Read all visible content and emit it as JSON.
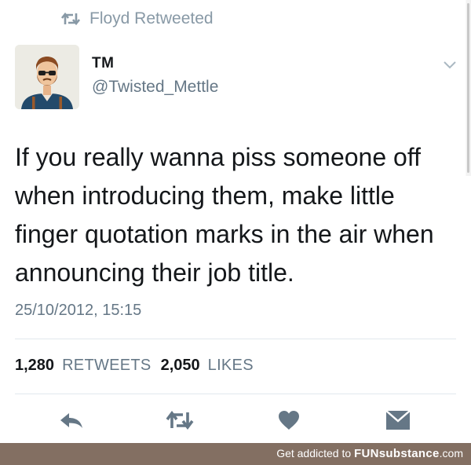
{
  "retweet_context": {
    "icon": "retweet-icon",
    "text": "Floyd Retweeted"
  },
  "author": {
    "avatar_icon": "bearded-man-avatar",
    "name": "TM",
    "handle": "@Twisted_Mettle"
  },
  "menu": {
    "icon": "chevron-down-icon"
  },
  "tweet": {
    "text_lines": [
      "If you really wanna piss someone off",
      "when introducing them, make little",
      "finger quotation marks in the air when",
      "announcing their job title."
    ],
    "timestamp": "25/10/2012, 15:15"
  },
  "stats": {
    "retweets_count": "1,280",
    "retweets_label": "RETWEETS",
    "likes_count": "2,050",
    "likes_label": "LIKES"
  },
  "actions": [
    {
      "name": "reply",
      "icon": "reply-icon"
    },
    {
      "name": "retweet",
      "icon": "retweet-icon"
    },
    {
      "name": "like",
      "icon": "heart-icon"
    },
    {
      "name": "direct-message",
      "icon": "envelope-icon"
    }
  ],
  "footer": {
    "prefix": "Get addicted to ",
    "brand": "FUNsubstance",
    "suffix": ".com"
  },
  "colors": {
    "text_primary": "#14171a",
    "text_secondary": "#657786",
    "icon_gray": "#8899a6",
    "footer_bg": "#836f62"
  }
}
